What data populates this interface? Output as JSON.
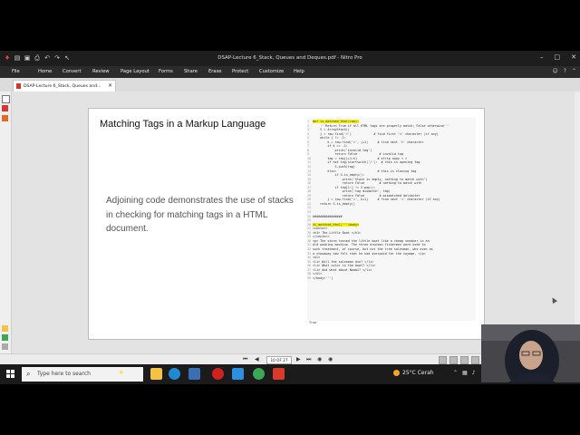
{
  "app": {
    "title": "DSAP-Lecture 6_Stack, Queues and Deques.pdf - Nitro Pro",
    "window_controls": [
      "–",
      "□",
      "✕"
    ],
    "quick_access": [
      "pdf-logo-icon",
      "open-icon",
      "save-icon",
      "print-icon",
      "undo-icon",
      "redo-icon",
      "cursor-tool-icon"
    ]
  },
  "menu": {
    "items": [
      "File",
      "Home",
      "Convert",
      "Review",
      "Page Layout",
      "Forms",
      "Share",
      "Erase",
      "Protect",
      "Customize",
      "Help"
    ]
  },
  "tab": {
    "label": "DSAP-Lecture 6_Stack, Queues and...",
    "close": "×"
  },
  "slide": {
    "title": "Matching Tags in a Markup Language",
    "body": "Adjoining code demonstrates the use of stacks in checking for matching tags in a HTML document."
  },
  "code": {
    "lines": [
      "def is_matched_html(raw):",
      "    '''Return True if all HTML tags are properly match; False otherwise'''",
      "    S = ArrayStack()",
      "    j = raw.find('<')            # find first '<' character (if any)",
      "    while j != -1:",
      "        k = raw.find('>', j+1)     # find next '>' character",
      "        if k == -1:",
      "            print('invalid tag')",
      "            return False            # invalid tag",
      "        tag = raw[j+1:k]           # strip away < >",
      "        if not tag.startswith('/'):  # this is opening tag",
      "            S.push(tag)",
      "        else:                      # this is closing tag",
      "            if S.is_empty():",
      "                print('Stack is empty, nothing to match with')",
      "                return False        # nothing to match with",
      "            if tag[1:] != S.pop():",
      "                print('tag mismatch', tag)",
      "                return False        # mismatched delimiter",
      "        j = raw.find('<', k+1)     # find next '<' character (if any)",
      "    return S.is_empty()",
      "",
      "",
      "################",
      "",
      "is_matched_html('''<body>",
      "<center>",
      "<h1> The Little Boat </h1>",
      "</center>",
      "<p> The storm tossed the little boat like a cheap sneaker in an",
      "old washing machine. The three drunken fishermen were used to",
      "such treatment, of course, but not the tree salesman, who even as",
      "a stowaway now felt that he had overpaid for the voyage. </p>",
      "<ol>",
      "<li> Will the salesman die? </li>",
      "<li> What color is the boat? </li>",
      "<li> And what about Naomi? </li>",
      "</ol>",
      "</body>''')"
    ],
    "highlight_lines": [
      0,
      25
    ],
    "output": "True"
  },
  "nav": {
    "page_display": "10 OF 27",
    "first": "⏮",
    "prev": "◀",
    "next": "▶",
    "last": "⏭",
    "back": "◉",
    "forward": "◉"
  },
  "taskbar": {
    "search_placeholder": "Type here to search",
    "weather": "25°C Cerah",
    "icons": [
      "sparkle-icon",
      "task-view-icon",
      "file-explorer-icon",
      "edge-icon",
      "mail-icon",
      "store-icon",
      "record-icon",
      "vscode-icon",
      "chrome-icon",
      "nitro-icon"
    ],
    "colors": {
      "file-explorer-icon": "#f5c242",
      "edge-icon": "#1f8ad2",
      "mail-icon": "#2a7fd4",
      "store-icon": "#3b6fb5",
      "record-icon": "#d02020",
      "vscode-icon": "#2c8fe0",
      "chrome-icon": "#3aa757",
      "nitro-icon": "#d93a2b"
    }
  }
}
